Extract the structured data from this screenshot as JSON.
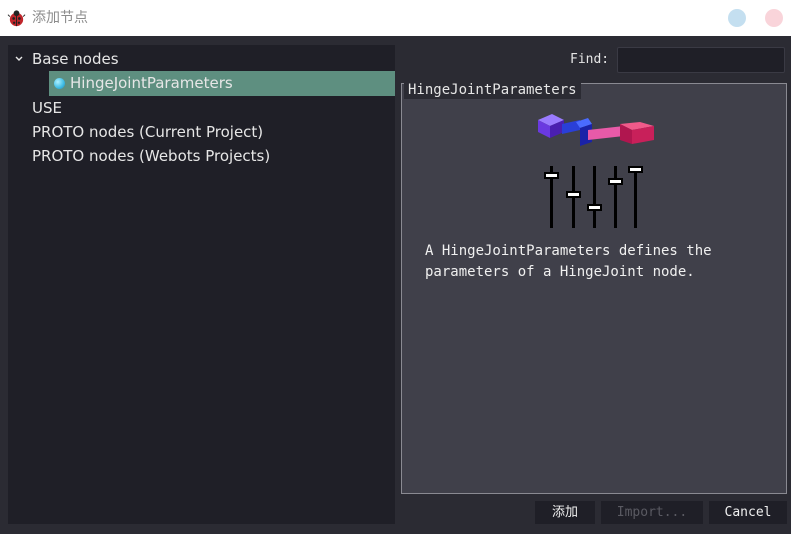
{
  "window": {
    "title": "添加节点",
    "app_icon": "ladybug-icon"
  },
  "tree": {
    "items": [
      {
        "label": "Base nodes",
        "expanded": true
      },
      {
        "label": "HingeJointParameters",
        "selected": true,
        "icon": "sphere-node-icon"
      },
      {
        "label": "USE"
      },
      {
        "label": "PROTO nodes (Current Project)"
      },
      {
        "label": "PROTO nodes (Webots Projects)"
      }
    ]
  },
  "find": {
    "label": "Find:",
    "value": ""
  },
  "description": {
    "title": "HingeJointParameters",
    "image": "hinge-joint-parameters-illustration",
    "text": "A HingeJointParameters defines the parameters of a HingeJoint node."
  },
  "buttons": {
    "add": "添加",
    "import": "Import...",
    "cancel": "Cancel"
  },
  "colors": {
    "background": "#2b2b33",
    "panel": "#1f1f27",
    "selection": "#5e8f80",
    "description_bg": "#40404a"
  }
}
